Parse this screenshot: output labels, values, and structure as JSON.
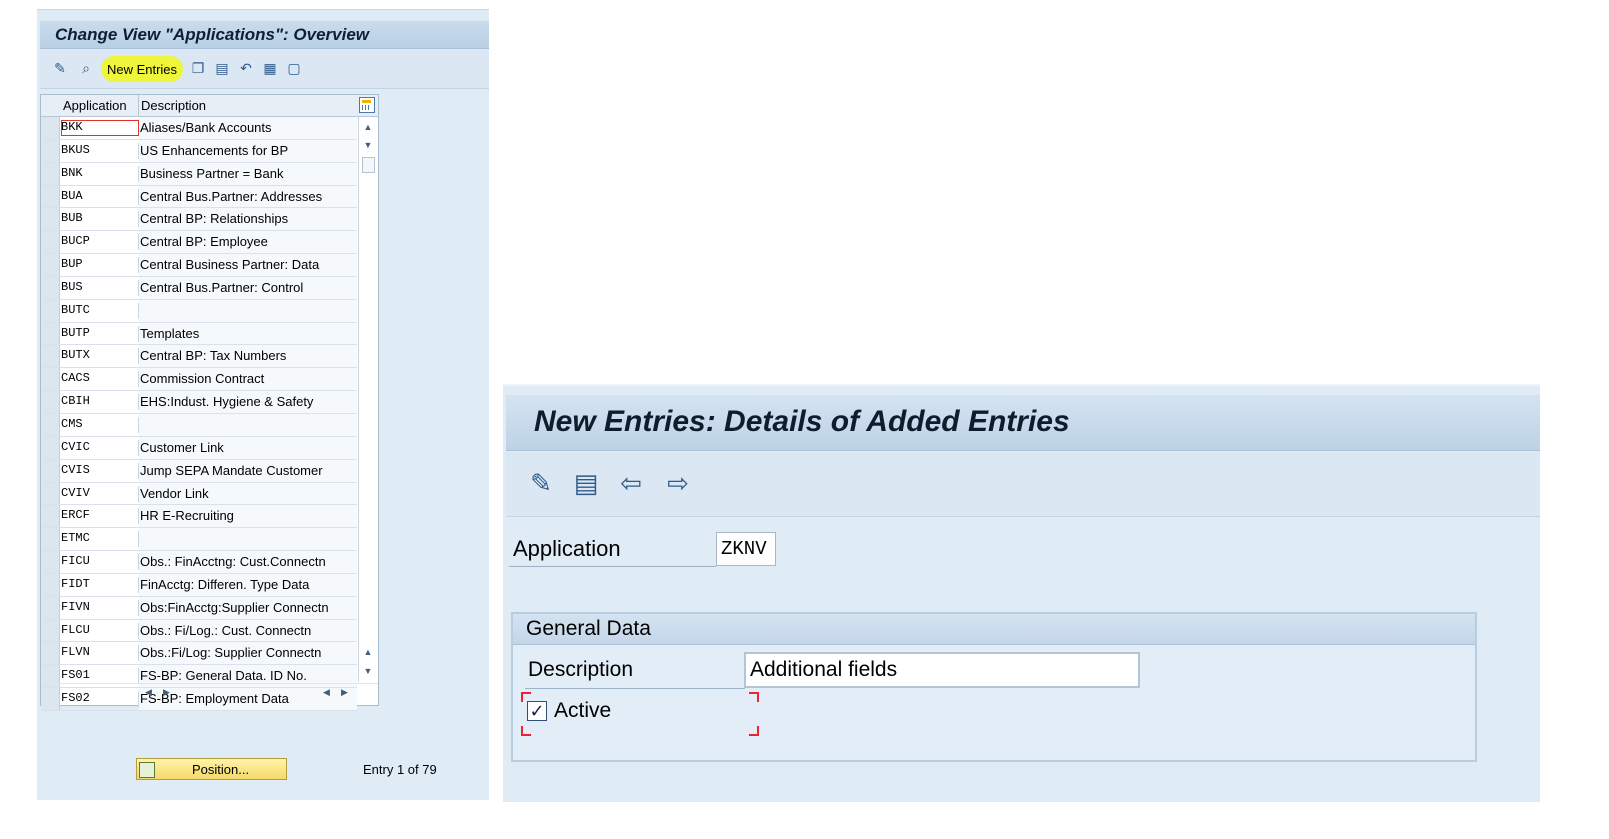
{
  "left_panel": {
    "title": "Change View \"Applications\": Overview",
    "toolbar": {
      "new_entries_label": "New Entries",
      "icons": [
        "display-change-icon",
        "find-icon",
        "copy-icon",
        "delete-icon",
        "undo-icon",
        "select-all-icon",
        "deselect-icon"
      ]
    },
    "table": {
      "columns": [
        "Application",
        "Description"
      ],
      "rows": [
        {
          "app": "BKK",
          "desc": "Aliases/Bank Accounts"
        },
        {
          "app": "BKUS",
          "desc": "US Enhancements for BP"
        },
        {
          "app": "BNK",
          "desc": "Business Partner = Bank"
        },
        {
          "app": "BUA",
          "desc": "Central Bus.Partner: Addresses"
        },
        {
          "app": "BUB",
          "desc": "Central BP: Relationships"
        },
        {
          "app": "BUCP",
          "desc": "Central BP: Employee"
        },
        {
          "app": "BUP",
          "desc": "Central Business Partner: Data"
        },
        {
          "app": "BUS",
          "desc": "Central Bus.Partner: Control"
        },
        {
          "app": "BUTC",
          "desc": ""
        },
        {
          "app": "BUTP",
          "desc": "Templates"
        },
        {
          "app": "BUTX",
          "desc": "Central BP: Tax Numbers"
        },
        {
          "app": "CACS",
          "desc": "Commission Contract"
        },
        {
          "app": "CBIH",
          "desc": "EHS:Indust. Hygiene & Safety"
        },
        {
          "app": "CMS",
          "desc": ""
        },
        {
          "app": "CVIC",
          "desc": "Customer Link"
        },
        {
          "app": "CVIS",
          "desc": "Jump SEPA Mandate Customer"
        },
        {
          "app": "CVIV",
          "desc": "Vendor Link"
        },
        {
          "app": "ERCF",
          "desc": "HR E-Recruiting"
        },
        {
          "app": "ETMC",
          "desc": ""
        },
        {
          "app": "FICU",
          "desc": "Obs.: FinAcctng: Cust.Connectn"
        },
        {
          "app": "FIDT",
          "desc": "FinAcctg: Differen. Type Data"
        },
        {
          "app": "FIVN",
          "desc": "Obs:FinAcctg:Supplier Connectn"
        },
        {
          "app": "FLCU",
          "desc": "Obs.: Fi/Log.: Cust. Connectn"
        },
        {
          "app": "FLVN",
          "desc": "Obs.:Fi/Log: Supplier Connectn"
        },
        {
          "app": "FS01",
          "desc": "FS-BP: General Data. ID No."
        },
        {
          "app": "FS02",
          "desc": "FS-BP: Employment Data"
        }
      ]
    },
    "position_button_label": "Position...",
    "entry_text": "Entry 1 of 79"
  },
  "right_panel": {
    "title": "New Entries: Details of Added Entries",
    "toolbar_icons": [
      "display-change-icon",
      "delete-icon",
      "previous-entry-icon",
      "next-entry-icon"
    ],
    "application_label": "Application",
    "application_value": "ZKNV",
    "group_title": "General Data",
    "description_label": "Description",
    "description_value": "Additional fields",
    "active_label": "Active",
    "active_checked": true,
    "checkmark": "✓"
  },
  "colors": {
    "highlight": "#eef53a",
    "panel_bg": "#dfebf5",
    "title_bg": "#c3d6e8",
    "focus_marker": "#e23333"
  }
}
